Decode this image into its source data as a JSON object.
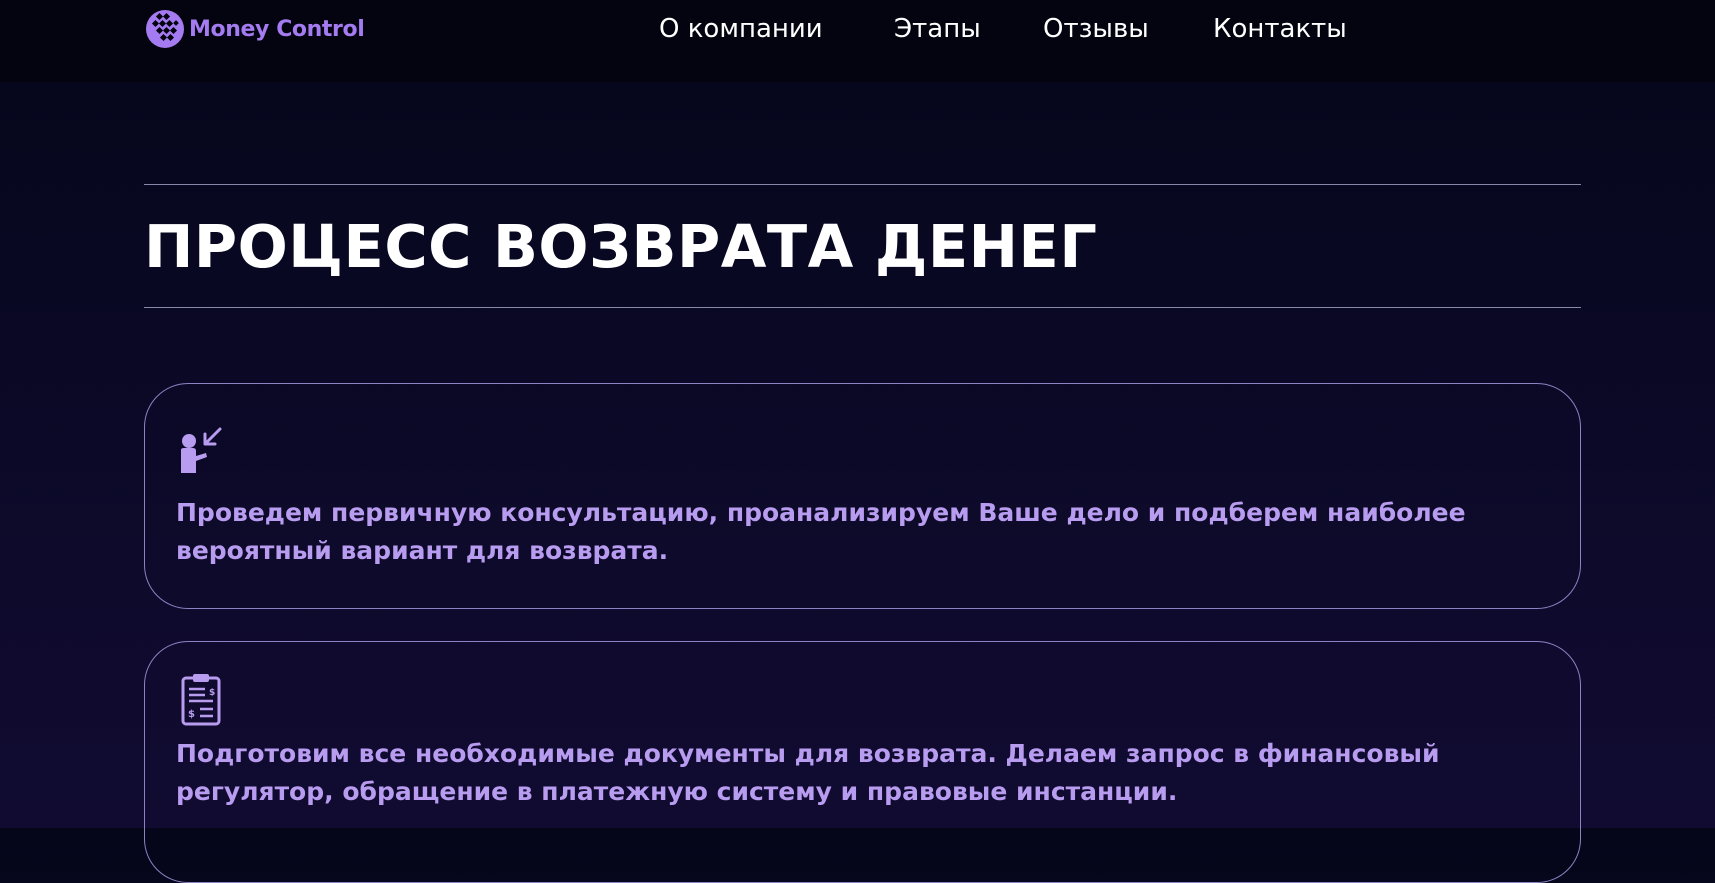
{
  "header": {
    "brand": "Money Control",
    "nav": [
      {
        "label": "О компании"
      },
      {
        "label": "Этапы"
      },
      {
        "label": "Отзывы"
      },
      {
        "label": "Контакты"
      }
    ]
  },
  "main": {
    "title": "ПРОЦЕСС ВОЗВРАТА ДЕНЕГ",
    "steps": [
      {
        "icon": "consultation-icon",
        "text": "Проведем первичную консультацию, проанализируем Ваше дело и подберем наиболее вероятный вариант для возврата."
      },
      {
        "icon": "clipboard-document-icon",
        "text": "Подготовим все необходимые документы для возврата. Делаем запрос в финансовый регулятор, обращение в платежную систему и правовые инстанции."
      }
    ]
  },
  "colors": {
    "accent": "#a47bf0",
    "card_text": "#b89cf0",
    "card_border": "#8c83c4",
    "background_top": "#05061a",
    "background_bottom": "#110b31"
  }
}
